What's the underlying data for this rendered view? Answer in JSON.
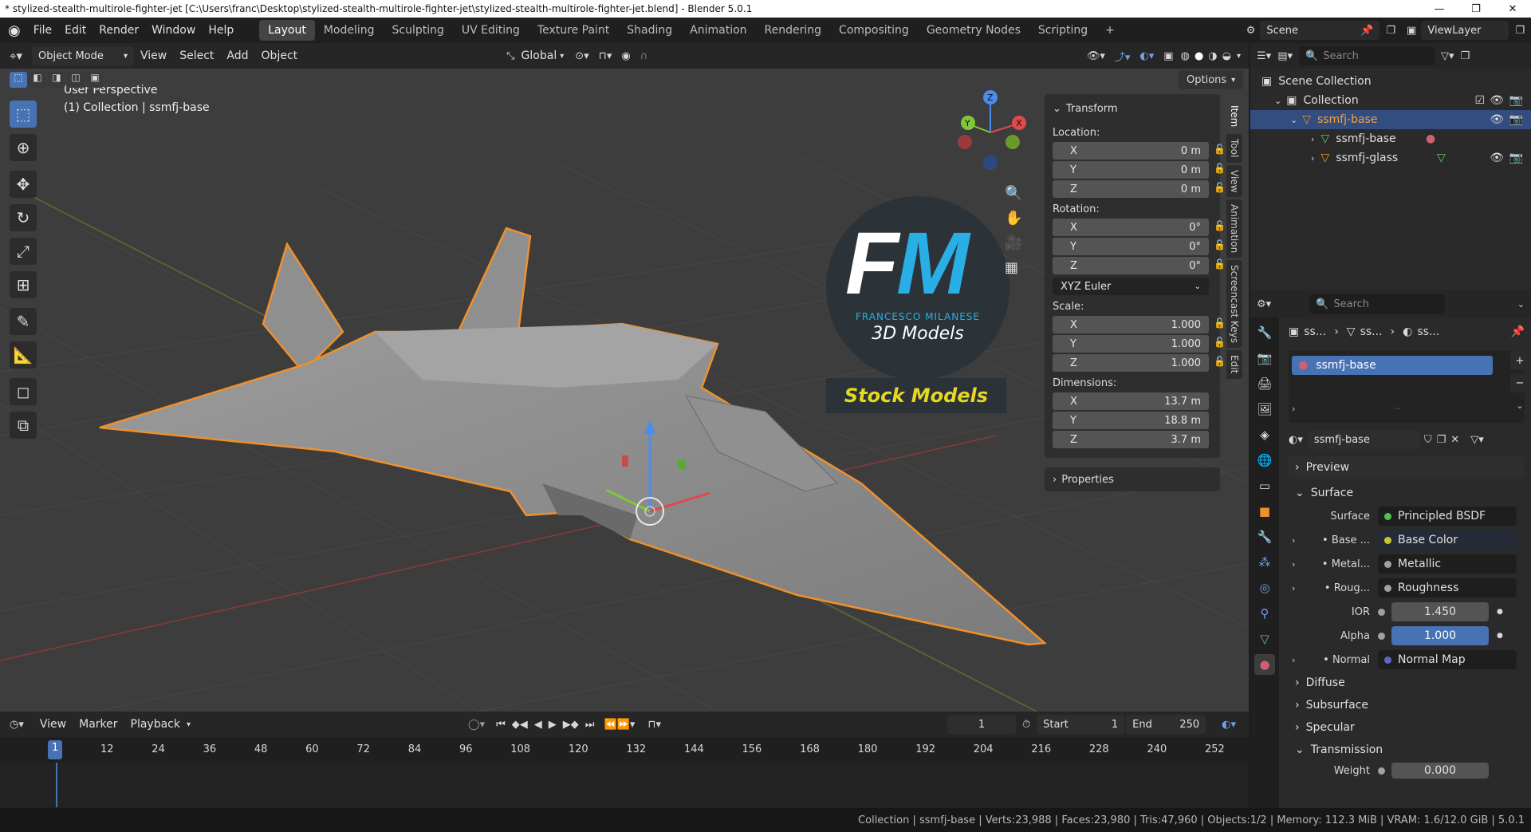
{
  "window": {
    "title": "* stylized-stealth-multirole-fighter-jet [C:\\Users\\franc\\Desktop\\stylized-stealth-multirole-fighter-jet\\stylized-stealth-multirole-fighter-jet.blend] - Blender 5.0.1"
  },
  "menu": {
    "file": "File",
    "edit": "Edit",
    "render": "Render",
    "window": "Window",
    "help": "Help"
  },
  "workspaces": [
    "Layout",
    "Modeling",
    "Sculpting",
    "UV Editing",
    "Texture Paint",
    "Shading",
    "Animation",
    "Rendering",
    "Compositing",
    "Geometry Nodes",
    "Scripting"
  ],
  "scene": {
    "name": "Scene",
    "view_layer": "ViewLayer"
  },
  "viewport_header": {
    "mode": "Object Mode",
    "view": "View",
    "select": "Select",
    "add": "Add",
    "object": "Object",
    "orientation": "Global",
    "options": "Options"
  },
  "viewport": {
    "perspective": "User Perspective",
    "collection_label": "(1) Collection | ssmfj-base"
  },
  "logo": {
    "initials_f": "F",
    "initials_m": "M",
    "name": "FRANCESCO MILANESE",
    "tagline": "3D Models",
    "banner": "Stock Models"
  },
  "gizmo": {
    "x": "X",
    "y": "Y",
    "z": "Z"
  },
  "npanel": {
    "transform": "Transform",
    "location": "Location:",
    "loc": [
      {
        "axis": "X",
        "value": "0 m"
      },
      {
        "axis": "Y",
        "value": "0 m"
      },
      {
        "axis": "Z",
        "value": "0 m"
      }
    ],
    "rotation": "Rotation:",
    "rot": [
      {
        "axis": "X",
        "value": "0°"
      },
      {
        "axis": "Y",
        "value": "0°"
      },
      {
        "axis": "Z",
        "value": "0°"
      }
    ],
    "rotation_mode": "XYZ Euler",
    "scale": "Scale:",
    "scl": [
      {
        "axis": "X",
        "value": "1.000"
      },
      {
        "axis": "Y",
        "value": "1.000"
      },
      {
        "axis": "Z",
        "value": "1.000"
      }
    ],
    "dimensions": "Dimensions:",
    "dim": [
      {
        "axis": "X",
        "value": "13.7 m"
      },
      {
        "axis": "Y",
        "value": "18.8 m"
      },
      {
        "axis": "Z",
        "value": "3.7 m"
      }
    ],
    "properties": "Properties"
  },
  "side_tabs": [
    "Item",
    "Tool",
    "View",
    "Animation",
    "Screencast Keys",
    "Edit"
  ],
  "timeline": {
    "view": "View",
    "marker": "Marker",
    "playback": "Playback",
    "current_frame": "1",
    "start_label": "Start",
    "start": "1",
    "end_label": "End",
    "end": "250",
    "ticks": [
      "1",
      "12",
      "24",
      "36",
      "48",
      "60",
      "72",
      "84",
      "96",
      "108",
      "120",
      "132",
      "144",
      "156",
      "168",
      "180",
      "192",
      "204",
      "216",
      "228",
      "240",
      "252"
    ]
  },
  "status": {
    "text": "Collection | ssmfj-base | Verts:23,988 | Faces:23,980 | Tris:47,960 | Objects:1/2 | Memory: 112.3 MiB | VRAM: 1.6/12.0 GiB | 5.0.1"
  },
  "outliner": {
    "search_placeholder": "Search",
    "scene_collection": "Scene Collection",
    "collection": "Collection",
    "items": [
      {
        "name": "ssmfj-base",
        "selected": true
      },
      {
        "name": "ssmfj-base",
        "selected": false
      },
      {
        "name": "ssmfj-glass",
        "selected": false
      }
    ]
  },
  "properties": {
    "search_placeholder": "Search",
    "breadcrumb": [
      "ss...",
      "ss...",
      "ss..."
    ],
    "slot": "ssmfj-base",
    "material_name": "ssmfj-base",
    "preview": "Preview",
    "surface_section": "Surface",
    "surface_label": "Surface",
    "surface_value": "Principled BSDF",
    "rows": [
      {
        "label": "Base ...",
        "value": "Base Color",
        "socket": "#c7c729"
      },
      {
        "label": "Metal...",
        "value": "Metallic",
        "socket": "#a1a1a1"
      },
      {
        "label": "Roug...",
        "value": "Roughness",
        "socket": "#a1a1a1"
      }
    ],
    "ior_label": "IOR",
    "ior": "1.450",
    "alpha_label": "Alpha",
    "alpha": "1.000",
    "normal_label": "Normal",
    "normal_value": "Normal Map",
    "sections": [
      "Diffuse",
      "Subsurface",
      "Specular",
      "Transmission"
    ],
    "weight_label": "Weight",
    "weight": "0.000"
  }
}
